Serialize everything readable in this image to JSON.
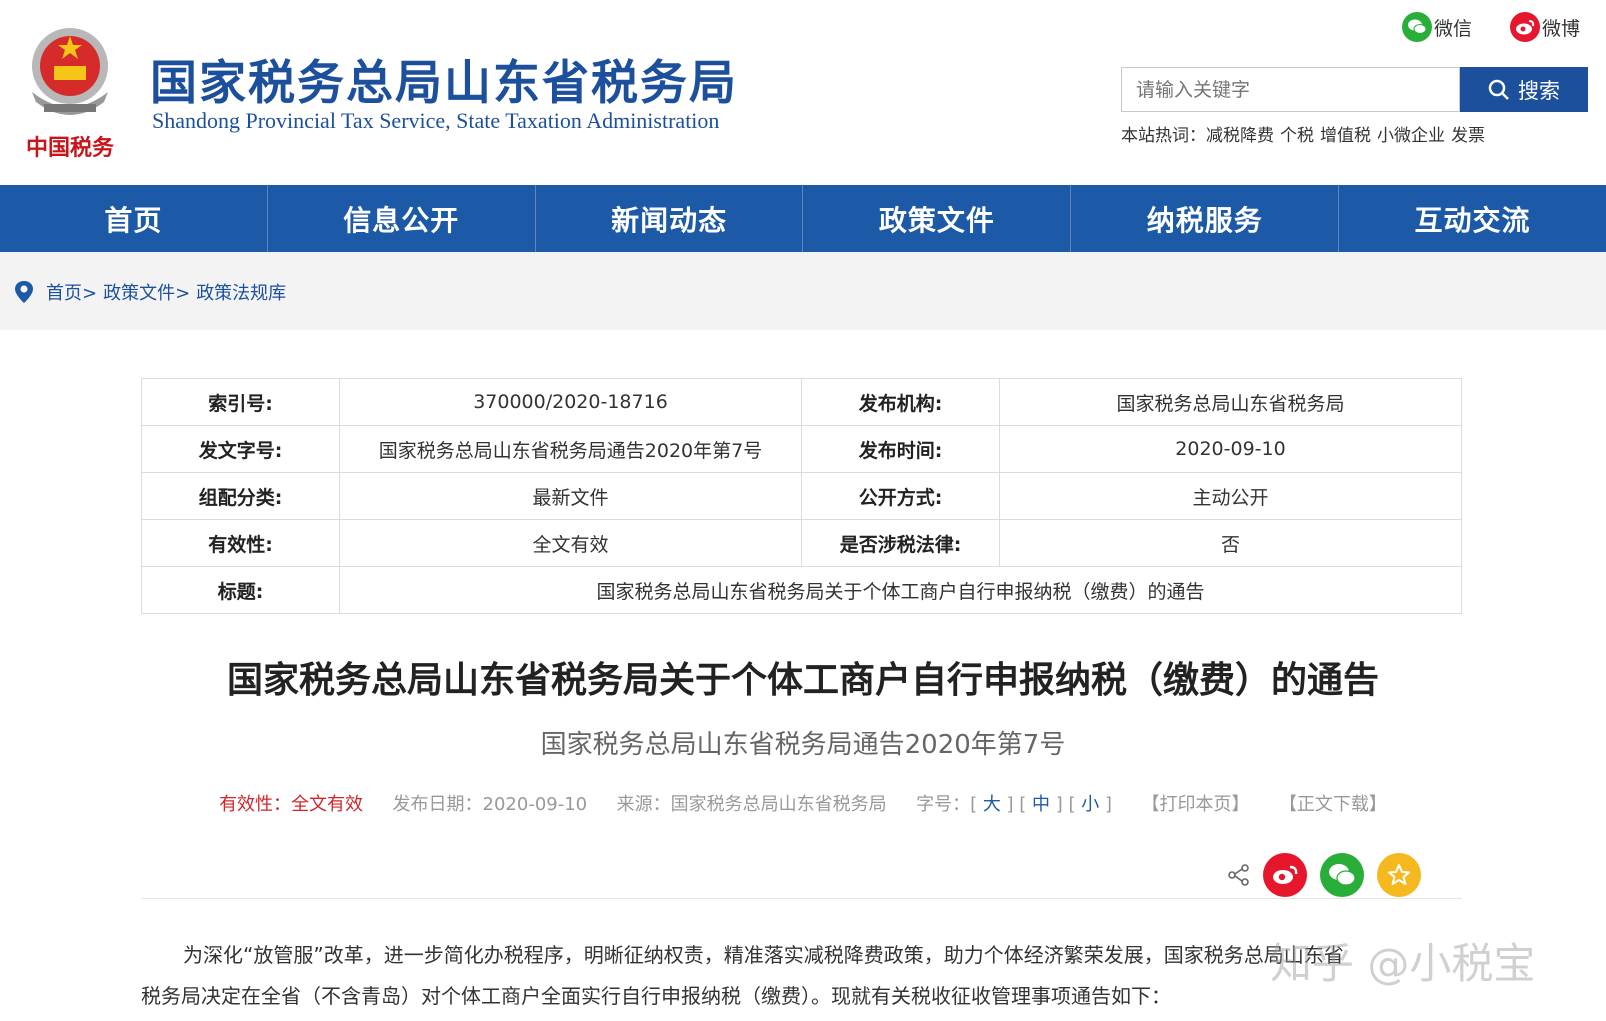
{
  "header": {
    "site_title": "国家税务总局山东省税务局",
    "site_subtitle": "Shandong Provincial Tax Service, State Taxation Administration",
    "emblem_text": "中国税务",
    "social": [
      {
        "label": "微信",
        "icon": "wechat-icon",
        "color": "#2aae3a"
      },
      {
        "label": "微博",
        "icon": "weibo-icon",
        "color": "#e6162d"
      }
    ],
    "search": {
      "placeholder": "请输入关键字",
      "button_label": "搜索"
    },
    "hotwords": {
      "label": "本站热词：",
      "items": [
        "减税降费",
        "个税",
        "增值税",
        "小微企业",
        "发票"
      ]
    }
  },
  "nav": {
    "items": [
      "首页",
      "信息公开",
      "新闻动态",
      "政策文件",
      "纳税服务",
      "互动交流"
    ]
  },
  "breadcrumb": {
    "items": [
      "首页>",
      "政策文件>",
      "政策法规库"
    ]
  },
  "meta": {
    "rows": [
      [
        {
          "k": "索引号:",
          "v": "370000/2020-18716"
        },
        {
          "k": "发布机构:",
          "v": "国家税务总局山东省税务局"
        }
      ],
      [
        {
          "k": "发文字号:",
          "v": "国家税务总局山东省税务局通告2020年第7号"
        },
        {
          "k": "发布时间:",
          "v": "2020-09-10"
        }
      ],
      [
        {
          "k": "组配分类:",
          "v": "最新文件"
        },
        {
          "k": "公开方式:",
          "v": "主动公开"
        }
      ],
      [
        {
          "k": "有效性:",
          "v": "全文有效"
        },
        {
          "k": "是否涉税法律:",
          "v": "否"
        }
      ]
    ],
    "title_row": {
      "k": "标题:",
      "v": "国家税务总局山东省税务局关于个体工商户自行申报纳税（缴费）的通告"
    }
  },
  "article": {
    "title": "国家税务总局山东省税务局关于个体工商户自行申报纳税（缴费）的通告",
    "subtitle": "国家税务总局山东省税务局通告2020年第7号",
    "info": {
      "validity_label": "有效性：",
      "validity_value": "全文有效",
      "date": "发布日期：2020-09-10",
      "source": "来源：国家税务总局山东省税务局",
      "font_label": "字号：",
      "font_large": "大",
      "font_medium": "中",
      "font_small": "小",
      "print": "【打印本页】",
      "download": "【正文下载】"
    },
    "share_colors": {
      "weibo": "#e6162d",
      "wechat": "#2aae3a",
      "favorite": "#f5b81e"
    },
    "paragraphs": [
      "为深化“放管服”改革，进一步简化办税程序，明晰征纳权责，精准落实减税降费政策，助力个体经济繁荣发展，国家税务总局山东省",
      "税务局决定在全省（不含青岛）对个体工商户全面实行自行申报纳税（缴费）。现就有关税收征收管理事项通告如下："
    ]
  },
  "watermark": "知乎 @小税宝"
}
